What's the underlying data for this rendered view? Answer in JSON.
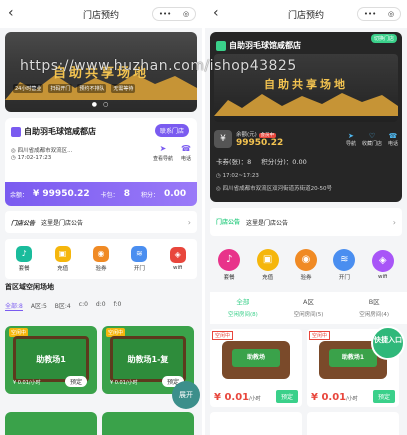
{
  "left": {
    "nav_title": "门店预约",
    "banner_title": "自助共享场地",
    "banner_tags": [
      "24小时营业",
      "扫码开门",
      "预约不排队",
      "无需等待"
    ],
    "store_name": "自助羽毛球馆咸都店",
    "contact_btn": "联系门店",
    "address": "四川省成都市双流区...",
    "hours": "17:02-17:23",
    "act_nav": "查看导航",
    "act_phone": "电话",
    "balance_label": "余额：",
    "balance_value": "¥ 99950.22",
    "card_label": "卡包：",
    "card_value": "8",
    "points_label": "积分：",
    "points_value": "0.00",
    "notice_badge": "门店公告",
    "notice_text": "这里是门店公告",
    "icons": [
      "套餐",
      "充值",
      "验券",
      "开门",
      "wifi"
    ],
    "section_title": "首区域空闲场地",
    "filters": [
      "全部:8",
      "A区:5",
      "B区:4",
      "c:0",
      "d:0",
      "f:0"
    ],
    "rooms": [
      {
        "tag": "空闲中",
        "name": "助教场1",
        "price": "¥ 0.01/小时",
        "book": "预定"
      },
      {
        "tag": "空闲中",
        "name": "助教场1-复",
        "price": "¥ 0.01/小时",
        "book": "预定"
      }
    ],
    "fab": "展开"
  },
  "right": {
    "nav_title": "门店预约",
    "store_name": "自助羽毛球馆咸都店",
    "switch_btn": "切换门店",
    "banner_title": "自助共享场地",
    "balance_label": "余额(元)",
    "member_badge": "会员中",
    "balance_value": "99950.22",
    "act_nav": "导航",
    "act_collect": "收藏门店",
    "act_phone": "电话",
    "card_text": "卡券(张)：8",
    "points_text": "积分(分)：0.00",
    "hours": "17:02~17:23",
    "address": "四川省成都市双流区双河街道苏街道20-50号",
    "notice_badge": "门店公告",
    "notice_text": "这里是门店公告",
    "icons": [
      "套餐",
      "充值",
      "验券",
      "开门",
      "wifi"
    ],
    "areas": [
      {
        "name": "全部",
        "sub": "空闲房间(8)"
      },
      {
        "name": "A区",
        "sub": "空闲房间(5)"
      },
      {
        "name": "B区",
        "sub": "空闲房间(4)"
      }
    ],
    "rooms": [
      {
        "tag": "空闲中",
        "name": "助教场",
        "price": "¥ 0.01",
        "unit": "/小时",
        "book": "预定"
      },
      {
        "tag": "空闲中",
        "name": "助教场1",
        "price": "¥ 0.01",
        "unit": "/小时",
        "book": "预定"
      }
    ],
    "fast_btn": "快捷入口"
  },
  "watermark": "https://www.huzhan.com/ishop43825"
}
